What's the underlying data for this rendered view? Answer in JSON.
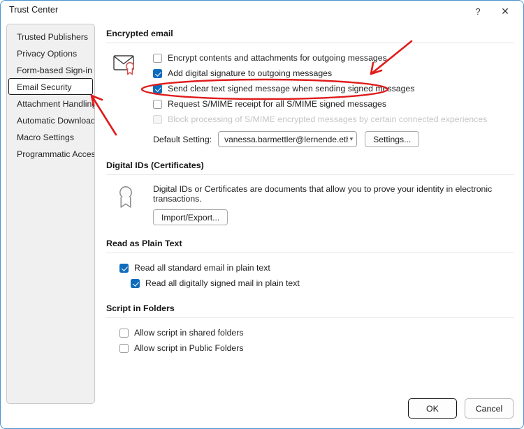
{
  "window": {
    "title": "Trust Center",
    "help_button": "?",
    "close_button": "✕"
  },
  "sidebar": {
    "items": [
      {
        "label": "Trusted Publishers",
        "selected": false
      },
      {
        "label": "Privacy Options",
        "selected": false
      },
      {
        "label": "Form-based Sign-in",
        "selected": false
      },
      {
        "label": "Email Security",
        "selected": true
      },
      {
        "label": "Attachment Handling",
        "selected": false
      },
      {
        "label": "Automatic Download",
        "selected": false
      },
      {
        "label": "Macro Settings",
        "selected": false
      },
      {
        "label": "Programmatic Access",
        "selected": false
      }
    ]
  },
  "sections": {
    "encrypted_email": {
      "heading": "Encrypted email",
      "icon": "envelope-certificate-icon",
      "checkboxes": [
        {
          "label": "Encrypt contents and attachments for outgoing messages",
          "checked": false,
          "disabled": false
        },
        {
          "label": "Add digital signature to outgoing messages",
          "checked": true,
          "disabled": false
        },
        {
          "label": "Send clear text signed message when sending signed messages",
          "checked": true,
          "disabled": false
        },
        {
          "label": "Request S/MIME receipt for all S/MIME signed messages",
          "checked": false,
          "disabled": false
        },
        {
          "label": "Block processing of S/MIME encrypted messages by certain connected experiences",
          "checked": false,
          "disabled": true
        }
      ],
      "default_setting_label": "Default Setting:",
      "default_setting_value": "vanessa.barmettler@lernende.ethz.ch",
      "settings_button": "Settings..."
    },
    "digital_ids": {
      "heading": "Digital IDs (Certificates)",
      "icon": "certificate-ribbon-icon",
      "description": "Digital IDs or Certificates are documents that allow you to prove your identity in electronic transactions.",
      "import_export_button": "Import/Export..."
    },
    "read_plain_text": {
      "heading": "Read as Plain Text",
      "checkboxes": [
        {
          "label": "Read all standard email in plain text",
          "checked": true,
          "disabled": false,
          "indent": 1
        },
        {
          "label": "Read all digitally signed mail in plain text",
          "checked": true,
          "disabled": false,
          "indent": 2
        }
      ]
    },
    "script_in_folders": {
      "heading": "Script in Folders",
      "checkboxes": [
        {
          "label": "Allow script in shared folders",
          "checked": false,
          "disabled": false,
          "indent": 1
        },
        {
          "label": "Allow script in Public Folders",
          "checked": false,
          "disabled": false,
          "indent": 1
        }
      ]
    }
  },
  "footer": {
    "ok_button": "OK",
    "cancel_button": "Cancel"
  },
  "annotations": {
    "color": "#e01b1b",
    "ellipse_target": "Send clear text signed message when sending signed messages",
    "arrow_1_target": "Send clear text signed message checkbox row",
    "arrow_2_target": "Email Security sidebar item"
  }
}
